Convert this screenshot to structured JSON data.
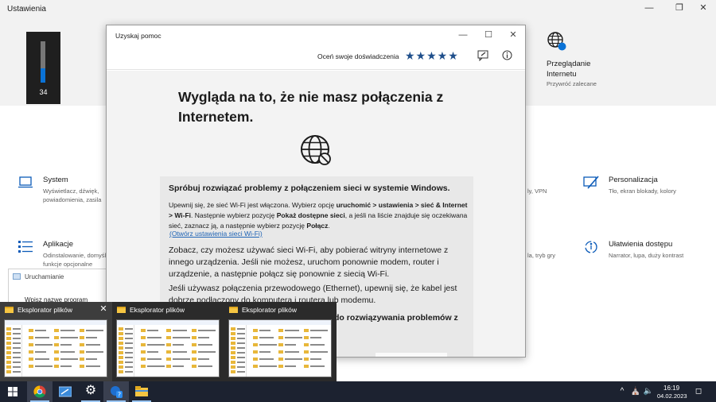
{
  "settings": {
    "title": "Ustawienia",
    "volume_value": "34",
    "volume_level": 0.34,
    "browse_tile": {
      "title": "Przeglądanie Internetu",
      "subtitle": "Przywróć zalecane"
    },
    "categories": [
      {
        "name": "system",
        "title": "System",
        "desc_line1": "Wyświetlacz, dźwięk,",
        "desc_line2": "powiadomienia, zasila"
      },
      {
        "name": "apps",
        "title": "Aplikacje",
        "desc_line1": "Odinstalowanie, domyślne,",
        "desc_line2": "funkcje opcjonalne"
      },
      {
        "name": "network-partial",
        "desc_line1": "ly, VPN"
      },
      {
        "name": "gaming-partial",
        "desc_line1": "la, tryb gry"
      },
      {
        "name": "personalization",
        "title": "Personalizacja",
        "desc_line1": "Tło, ekran blokady, kolory"
      },
      {
        "name": "accessibility",
        "title": "Ułatwienia dostępu",
        "desc_line1": "Narrator, lupa, duży kontrast"
      }
    ]
  },
  "run_dialog": {
    "title": "Uruchamianie",
    "text": "Wpisz nazwę program"
  },
  "help": {
    "title": "Uzyskaj pomoc",
    "rate_label": "Oceń swoje doświadczenia",
    "stars": "★★★★★",
    "heading": "Wygląda na to, że nie masz połączenia z Internetem.",
    "trouble_title": "Spróbuj rozwiązać problemy z połączeniem sieci w systemie Windows.",
    "wifi_para_1": "Upewnij się, że sieć Wi-Fi jest włączona. Wybierz opcję ",
    "wifi_bold_1": "uruchomić > ustawienia > sieć & Internet > Wi-Fi",
    "wifi_para_2": ". Następnie wybierz pozycję ",
    "wifi_bold_2": "Pokaż dostępne sieci",
    "wifi_para_3": ", a jeśli na liście znajduje się oczekiwana sieć, zaznacz ją, a następnie wybierz pozycję ",
    "wifi_bold_3": "Połącz",
    "wifi_para_4": ".",
    "wifi_link": "(Otwórz ustawienia sieci Wi-Fi)",
    "para2": "Zobacz, czy możesz używać sieci Wi-Fi, aby pobierać witryny internetowe z innego urządzenia. Jeśli nie możesz, uruchom ponownie modem, router i urządzenie, a następnie połącz się ponownie z siecią Wi-Fi.",
    "para3": "Jeśli używasz połączenia przewodowego (Ethernet), upewnij się, że kabel jest dobrze podłączony do komputera i routera lub modemu.",
    "para4": "do rozwiązywania problemów z"
  },
  "thumbnails": [
    {
      "title": "Eksplorator plików",
      "close": "✕"
    },
    {
      "title": "Eksplorator plików"
    },
    {
      "title": "Eksplorator plików"
    }
  ],
  "taskbar": {
    "time": "16:19",
    "date": "04.02.2023"
  }
}
